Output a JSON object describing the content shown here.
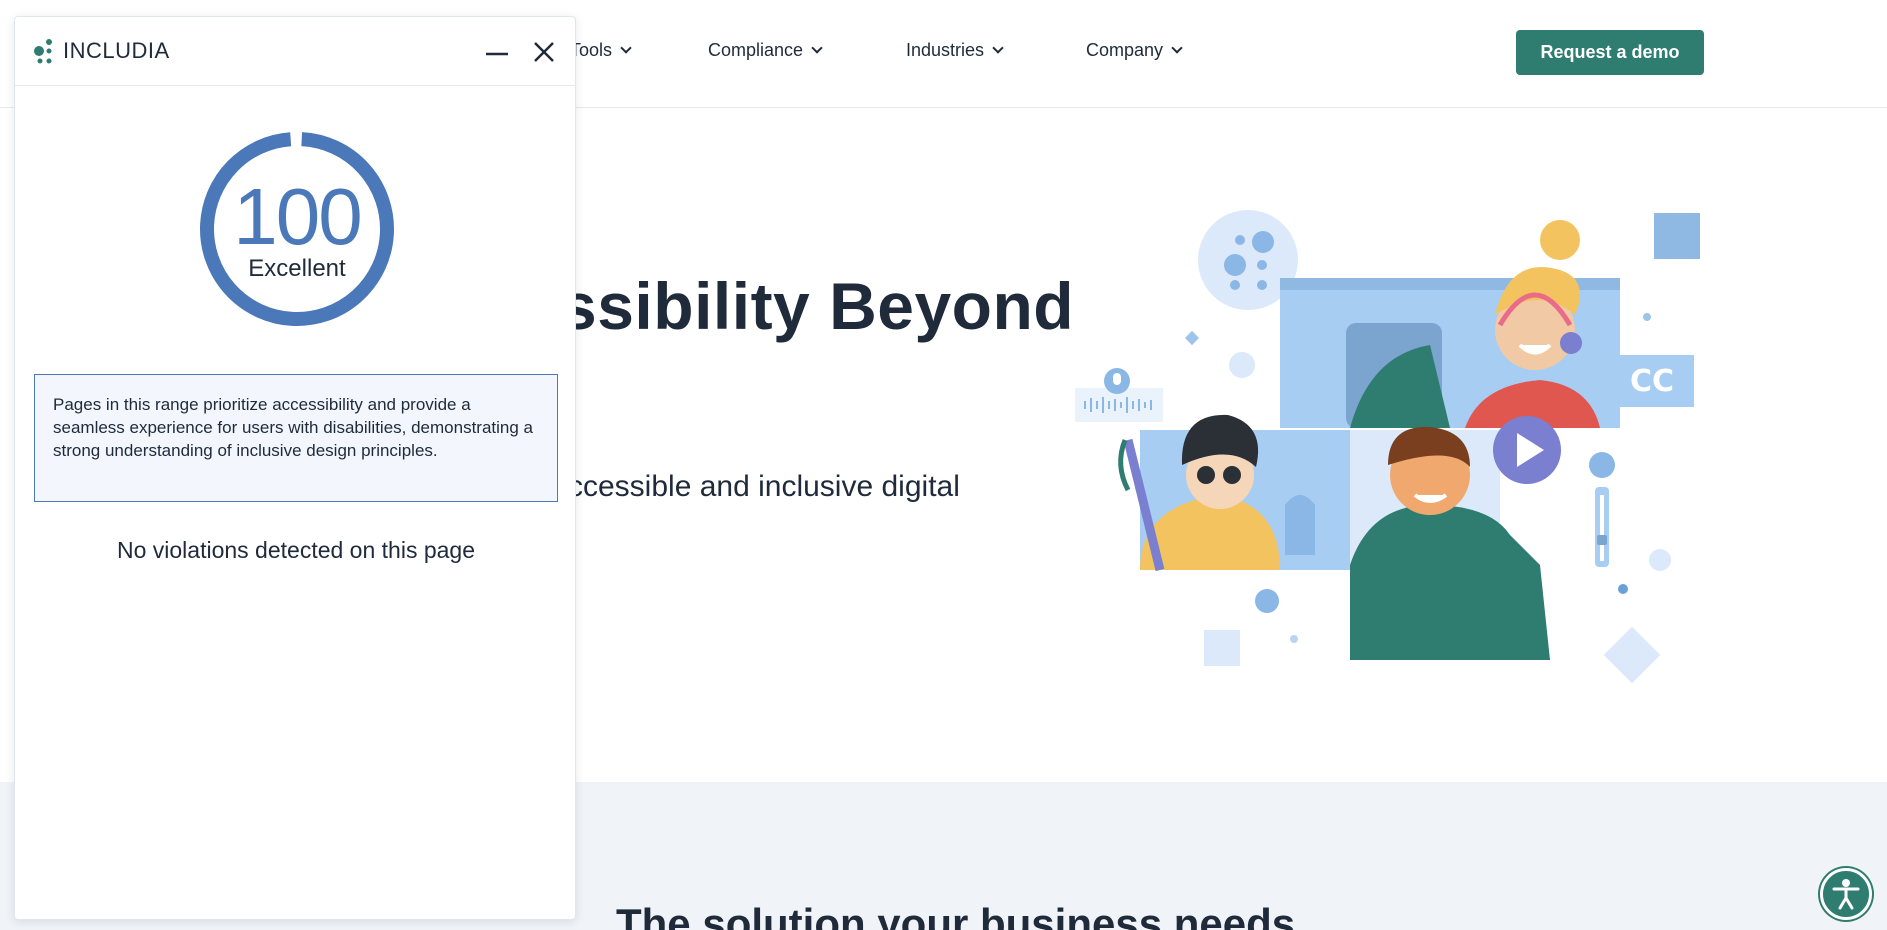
{
  "nav": {
    "items": [
      {
        "label": "Tools"
      },
      {
        "label": "Compliance"
      },
      {
        "label": "Industries"
      },
      {
        "label": "Company"
      }
    ],
    "cta_label": "Request a demo"
  },
  "hero": {
    "title": "ssibility Beyond",
    "subtitle": "ccessible and inclusive digital",
    "captions_badge": "CC"
  },
  "lower": {
    "title": "The solution your business needs"
  },
  "panel": {
    "brand": "INCLUDIA",
    "score": {
      "value": "100",
      "label": "Excellent",
      "fraction": 0.98
    },
    "description": "Pages in this range prioritize accessibility and provide a seamless experience for users with disabilities, demonstrating a strong understanding of inclusive design principles.",
    "status": "No violations detected on this page"
  },
  "colors": {
    "brand_teal": "#2f7c70",
    "score_blue": "#4a78b8",
    "text_dark": "#1f2a3a",
    "band_bg": "#f0f3f8"
  },
  "icons": {
    "minimize": "minimize-icon",
    "close": "close-icon",
    "accessibility": "accessibility-person-icon"
  }
}
